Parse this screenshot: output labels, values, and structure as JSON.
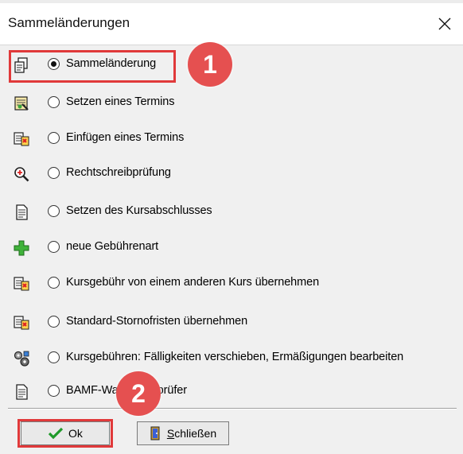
{
  "window": {
    "title": "Sammeländerungen",
    "close_label": "×"
  },
  "options": [
    {
      "label": "Sammeländerung",
      "checked": true,
      "icon": "copy-pages-icon"
    },
    {
      "label": "Setzen eines Termins",
      "checked": false,
      "icon": "set-date-icon"
    },
    {
      "label": "Einfügen eines Termins",
      "checked": false,
      "icon": "insert-date-icon"
    },
    {
      "label": "Rechtschreibprüfung",
      "checked": false,
      "icon": "spellcheck-magnifier-icon"
    },
    {
      "label": "Setzen des Kursabschlusses",
      "checked": false,
      "icon": "document-icon"
    },
    {
      "label": "neue Gebührenart",
      "checked": false,
      "icon": "green-plus-icon"
    },
    {
      "label": "Kursgebühr von einem anderen Kurs übernehmen",
      "checked": false,
      "icon": "transfer-fee-icon"
    },
    {
      "label": "Standard-Stornofristen übernehmen",
      "checked": false,
      "icon": "transfer-cancellation-icon"
    },
    {
      "label": "Kursgebühren: Fälligkeiten verschieben, Ermäßigungen bearbeiten",
      "checked": false,
      "icon": "gears-icon"
    },
    {
      "label": "BAMF-Wartelistesprüfer",
      "checked": false,
      "icon": "document-icon"
    }
  ],
  "buttons": {
    "ok_label": "Ok",
    "close_first": "S",
    "close_rest": "chließen"
  },
  "annotations": {
    "badge_1": "1",
    "badge_2": "2",
    "highlight_color": "#e0393a"
  }
}
